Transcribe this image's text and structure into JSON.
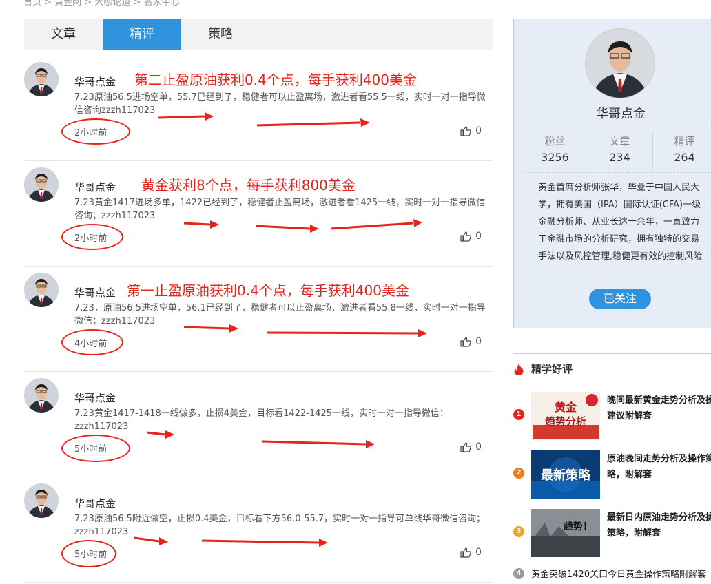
{
  "breadcrumb": "首页 > 黄金网 > 大咖论道 > 名家中心",
  "tabs": [
    "文章",
    "精评",
    "策略"
  ],
  "posts": [
    {
      "author": "华哥点金",
      "headline": "第二止盈原油获利0.4个点，每手获利400美金",
      "text": "7.23原油56.5进场空单，55.7已经到了，稳健者可以止盈离场，激进者看55.5一线，实时一对一指导微信咨询zzzh117023",
      "time": "2小时前",
      "likes": "0"
    },
    {
      "author": "华哥点金",
      "headline": "黄金获利8个点，每手获利800美金",
      "text": "7.23黄金1417进场多单，1422已经到了，稳健者止盈离场，激进者看1425一线，实时一对一指导微信咨询；zzzh117023",
      "time": "2小时前",
      "likes": "0"
    },
    {
      "author": "华哥点金",
      "headline": "第一止盈原油获利0.4个点，每手获利400美金",
      "text": "7.23，原油56.5进场空单，56.1已经到了，稳健者可以止盈离场，激进者看55.8一线，实时一对一指导微信；zzzh117023",
      "time": "4小时前",
      "likes": "0"
    },
    {
      "author": "华哥点金",
      "headline": "",
      "text": "7.23黄金1417-1418一线做多，止损4美金，目标看1422-1425一线，实时一对一指导微信；zzzh117023",
      "time": "5小时前",
      "likes": "0"
    },
    {
      "author": "华哥点金",
      "headline": "",
      "text": "7.23原油56.5附近做空，止损0.4美金，目标看下方56.0-55.7，实时一对一指导可单线华哥微信咨询；zzzh117023",
      "time": "5小时前",
      "likes": "0"
    }
  ],
  "profile": {
    "name": "华哥点金",
    "stats": [
      {
        "label": "粉丝",
        "value": "3256"
      },
      {
        "label": "文章",
        "value": "234"
      },
      {
        "label": "精评",
        "value": "264"
      }
    ],
    "bio": "黄金首席分析师张华，毕业于中国人民大学，拥有美国（IPA）国际认证(CFA)一级金融分析师、从业长达十余年，一直致力于金融市场的分析研究，拥有独特的交易手法以及风控管理,稳健更有效的控制风险",
    "follow_label": "已关注"
  },
  "recommended": {
    "title": "精学好评",
    "items": [
      {
        "rank": "1",
        "title": "晚间最新黄金走势分析及操作建议附解套",
        "thumb_text_a": "黄金",
        "thumb_text_b": "趋势分析"
      },
      {
        "rank": "2",
        "title": "原油晚间走势分析及操作策略，附解套",
        "thumb_text_a": "最新策略"
      },
      {
        "rank": "3",
        "title": "最新日内原油走势分析及操作策略，附解套",
        "thumb_text_a": "趋势！"
      },
      {
        "rank": "4",
        "title": "黄金突破1420关口今日黄金操作策略附解套"
      }
    ]
  },
  "colors": {
    "accent": "#2f93dd",
    "annotation_red": "#e8231b",
    "rank1": "#e8231b",
    "rank2": "#f07c22",
    "rank3": "#f2a41c",
    "rank4": "#9a9a9a"
  }
}
